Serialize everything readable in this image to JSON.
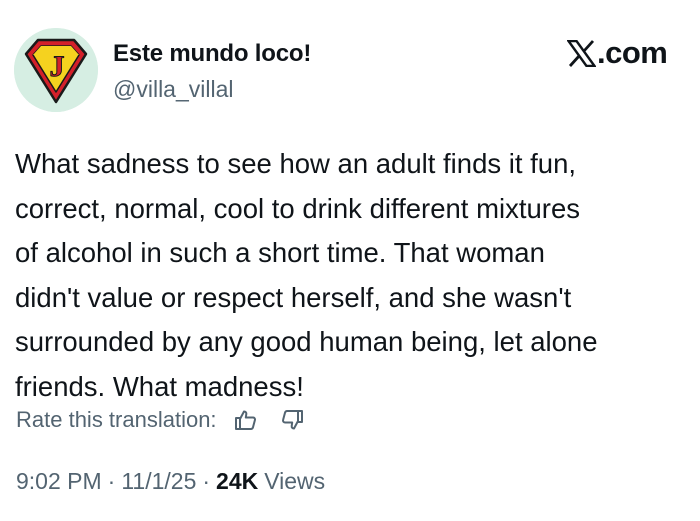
{
  "author": {
    "display_name": "Este mundo loco!",
    "handle": "@villa_villal",
    "avatar_icon": "superhero-j-shield-icon",
    "avatar_letter": "J"
  },
  "brand": {
    "icon": "x-logo-icon",
    "label": ".com"
  },
  "tweet": {
    "lines": [
      "What sadness to see how an adult finds it fun,",
      "correct, normal, cool to drink different mixtures",
      "of alcohol in such a short time. That woman",
      "didn't value or respect herself, and she wasn't",
      "surrounded by any good human being, let alone",
      "friends. What madness!"
    ]
  },
  "translation": {
    "rate_label": "Rate this translation:",
    "thumbs_up_icon": "thumbs-up-icon",
    "thumbs_down_icon": "thumbs-down-icon"
  },
  "meta": {
    "time": "9:02 PM",
    "separator": "·",
    "date": "11/1/25",
    "views_count": "24K",
    "views_label": "Views"
  },
  "colors": {
    "text_primary": "#0f1419",
    "text_secondary": "#536471",
    "avatar_bg": "#d6eee3",
    "shield_red": "#d4202a",
    "shield_yellow": "#f5d21f"
  }
}
